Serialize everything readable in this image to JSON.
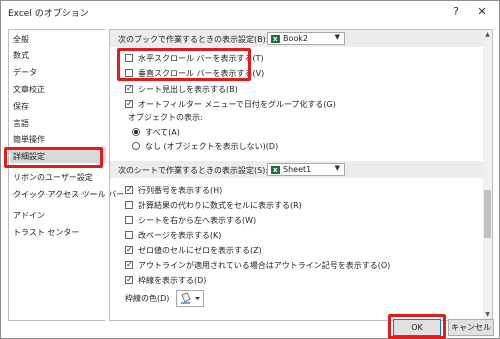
{
  "window": {
    "title": "Excel のオプション",
    "help_glyph": "?",
    "close_glyph": "✕"
  },
  "sidebar": {
    "items": [
      {
        "label": "全般"
      },
      {
        "label": "数式"
      },
      {
        "label": "データ"
      },
      {
        "label": "文章校正"
      },
      {
        "label": "保存"
      },
      {
        "label": "言語"
      },
      {
        "label": "簡単操作"
      },
      {
        "label": "詳細設定"
      },
      {
        "label": "リボンのユーザー設定"
      },
      {
        "label": "クイック アクセス ツール バー"
      },
      {
        "label": "アドイン"
      },
      {
        "label": "トラスト センター"
      }
    ],
    "selected": "詳細設定"
  },
  "workbook_section": {
    "label": "次のブックで作業するときの表示設定(B):",
    "dropdown_value": "Book2",
    "options": [
      {
        "label": "水平スクロール バーを表示する(T)",
        "checked": false
      },
      {
        "label": "垂直スクロール バーを表示する(V)",
        "checked": false
      },
      {
        "label": "シート見出しを表示する(B)",
        "checked": true
      },
      {
        "label": "オートフィルター メニューで日付をグループ化する(G)",
        "checked": true
      }
    ],
    "objects_label": "オブジェクトの表示:",
    "radio_all": "すべて(A)",
    "radio_none": "なし (オブジェクトを表示しない)(D)"
  },
  "sheet_section": {
    "label": "次のシートで作業するときの表示設定(S):",
    "dropdown_value": "Sheet1",
    "options": [
      {
        "label": "行列番号を表示する(H)",
        "checked": true
      },
      {
        "label": "計算結果の代わりに数式をセルに表示する(R)",
        "checked": false
      },
      {
        "label": "シートを右から左へ表示する(W)",
        "checked": false
      },
      {
        "label": "改ページを表示する(K)",
        "checked": false
      },
      {
        "label": "ゼロ値のセルにゼロを表示する(Z)",
        "checked": true
      },
      {
        "label": "アウトラインが適用されている場合はアウトライン記号を表示する(O)",
        "checked": true
      },
      {
        "label": "枠線を表示する(D)",
        "checked": true
      }
    ],
    "gridline_color_label": "枠線の色(D)"
  },
  "buttons": {
    "ok": "OK",
    "cancel": "キャンセル"
  },
  "colors": {
    "highlight_red": "#e01c1c",
    "excel_green": "#1d7044",
    "selected_bg": "#d9d9d9"
  }
}
